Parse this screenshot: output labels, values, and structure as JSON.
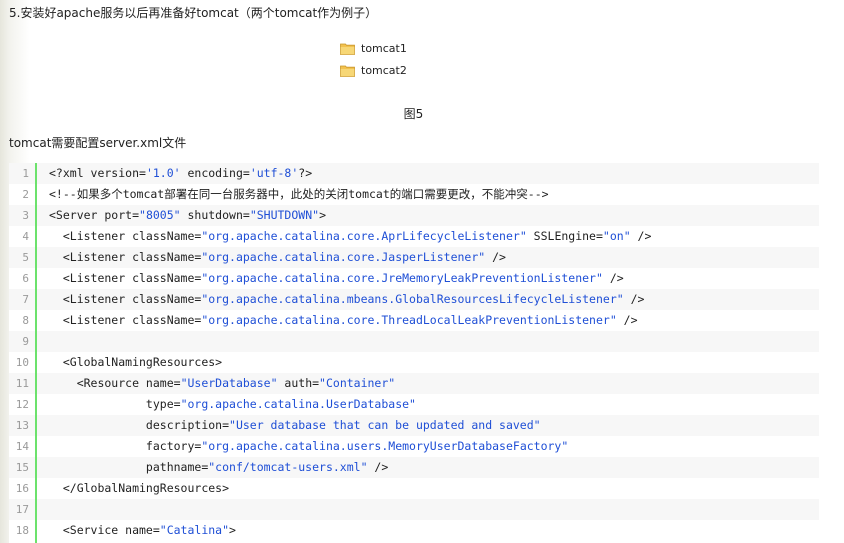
{
  "heading": "5.安装好apache服务以后再准备好tomcat（两个tomcat作为例子）",
  "folders": [
    {
      "name": "tomcat1",
      "icon": "folder-icon"
    },
    {
      "name": "tomcat2",
      "icon": "folder-icon"
    }
  ],
  "figure_caption": "图5",
  "config_note": "tomcat需要配置server.xml文件",
  "colors": {
    "gutter_bar": "#6ce26c",
    "string": "#1f4fd6",
    "alt_row": "#f7f7f7",
    "folder": "#f2c14e"
  },
  "code_lines": [
    {
      "n": "1",
      "tokens": [
        [
          "t",
          "<?xml version="
        ],
        [
          "s",
          "'1.0'"
        ],
        [
          "t",
          " encoding="
        ],
        [
          "s",
          "'utf-8'"
        ],
        [
          "t",
          "?>"
        ]
      ]
    },
    {
      "n": "2",
      "tokens": [
        [
          "c",
          "<!--如果多个tomcat部署在同一台服务器中，此处的关闭tomcat的端口需要更改，不能冲突-->"
        ]
      ]
    },
    {
      "n": "3",
      "tokens": [
        [
          "t",
          "<Server port="
        ],
        [
          "s",
          "\"8005\""
        ],
        [
          "t",
          " shutdown="
        ],
        [
          "s",
          "\"SHUTDOWN\""
        ],
        [
          "t",
          ">"
        ]
      ]
    },
    {
      "n": "4",
      "tokens": [
        [
          "t",
          "  <Listener className="
        ],
        [
          "s",
          "\"org.apache.catalina.core.AprLifecycleListener\""
        ],
        [
          "t",
          " SSLEngine="
        ],
        [
          "s",
          "\"on\""
        ],
        [
          "t",
          " />"
        ]
      ]
    },
    {
      "n": "5",
      "tokens": [
        [
          "t",
          "  <Listener className="
        ],
        [
          "s",
          "\"org.apache.catalina.core.JasperListener\""
        ],
        [
          "t",
          " />"
        ]
      ]
    },
    {
      "n": "6",
      "tokens": [
        [
          "t",
          "  <Listener className="
        ],
        [
          "s",
          "\"org.apache.catalina.core.JreMemoryLeakPreventionListener\""
        ],
        [
          "t",
          " />"
        ]
      ]
    },
    {
      "n": "7",
      "tokens": [
        [
          "t",
          "  <Listener className="
        ],
        [
          "s",
          "\"org.apache.catalina.mbeans.GlobalResourcesLifecycleListener\""
        ],
        [
          "t",
          " />"
        ]
      ]
    },
    {
      "n": "8",
      "tokens": [
        [
          "t",
          "  <Listener className="
        ],
        [
          "s",
          "\"org.apache.catalina.core.ThreadLocalLeakPreventionListener\""
        ],
        [
          "t",
          " />"
        ]
      ]
    },
    {
      "n": "9",
      "tokens": []
    },
    {
      "n": "10",
      "tokens": [
        [
          "t",
          "  <GlobalNamingResources>"
        ]
      ]
    },
    {
      "n": "11",
      "tokens": [
        [
          "t",
          "    <Resource name="
        ],
        [
          "s",
          "\"UserDatabase\""
        ],
        [
          "t",
          " auth="
        ],
        [
          "s",
          "\"Container\""
        ]
      ]
    },
    {
      "n": "12",
      "tokens": [
        [
          "t",
          "              type="
        ],
        [
          "s",
          "\"org.apache.catalina.UserDatabase\""
        ]
      ]
    },
    {
      "n": "13",
      "tokens": [
        [
          "t",
          "              description="
        ],
        [
          "s",
          "\"User database that can be updated and saved\""
        ]
      ]
    },
    {
      "n": "14",
      "tokens": [
        [
          "t",
          "              factory="
        ],
        [
          "s",
          "\"org.apache.catalina.users.MemoryUserDatabaseFactory\""
        ]
      ]
    },
    {
      "n": "15",
      "tokens": [
        [
          "t",
          "              pathname="
        ],
        [
          "s",
          "\"conf/tomcat-users.xml\""
        ],
        [
          "t",
          " />"
        ]
      ]
    },
    {
      "n": "16",
      "tokens": [
        [
          "t",
          "  </GlobalNamingResources>"
        ]
      ]
    },
    {
      "n": "17",
      "tokens": []
    },
    {
      "n": "18",
      "tokens": [
        [
          "t",
          "  <Service name="
        ],
        [
          "s",
          "\"Catalina\""
        ],
        [
          "t",
          ">"
        ]
      ]
    }
  ]
}
